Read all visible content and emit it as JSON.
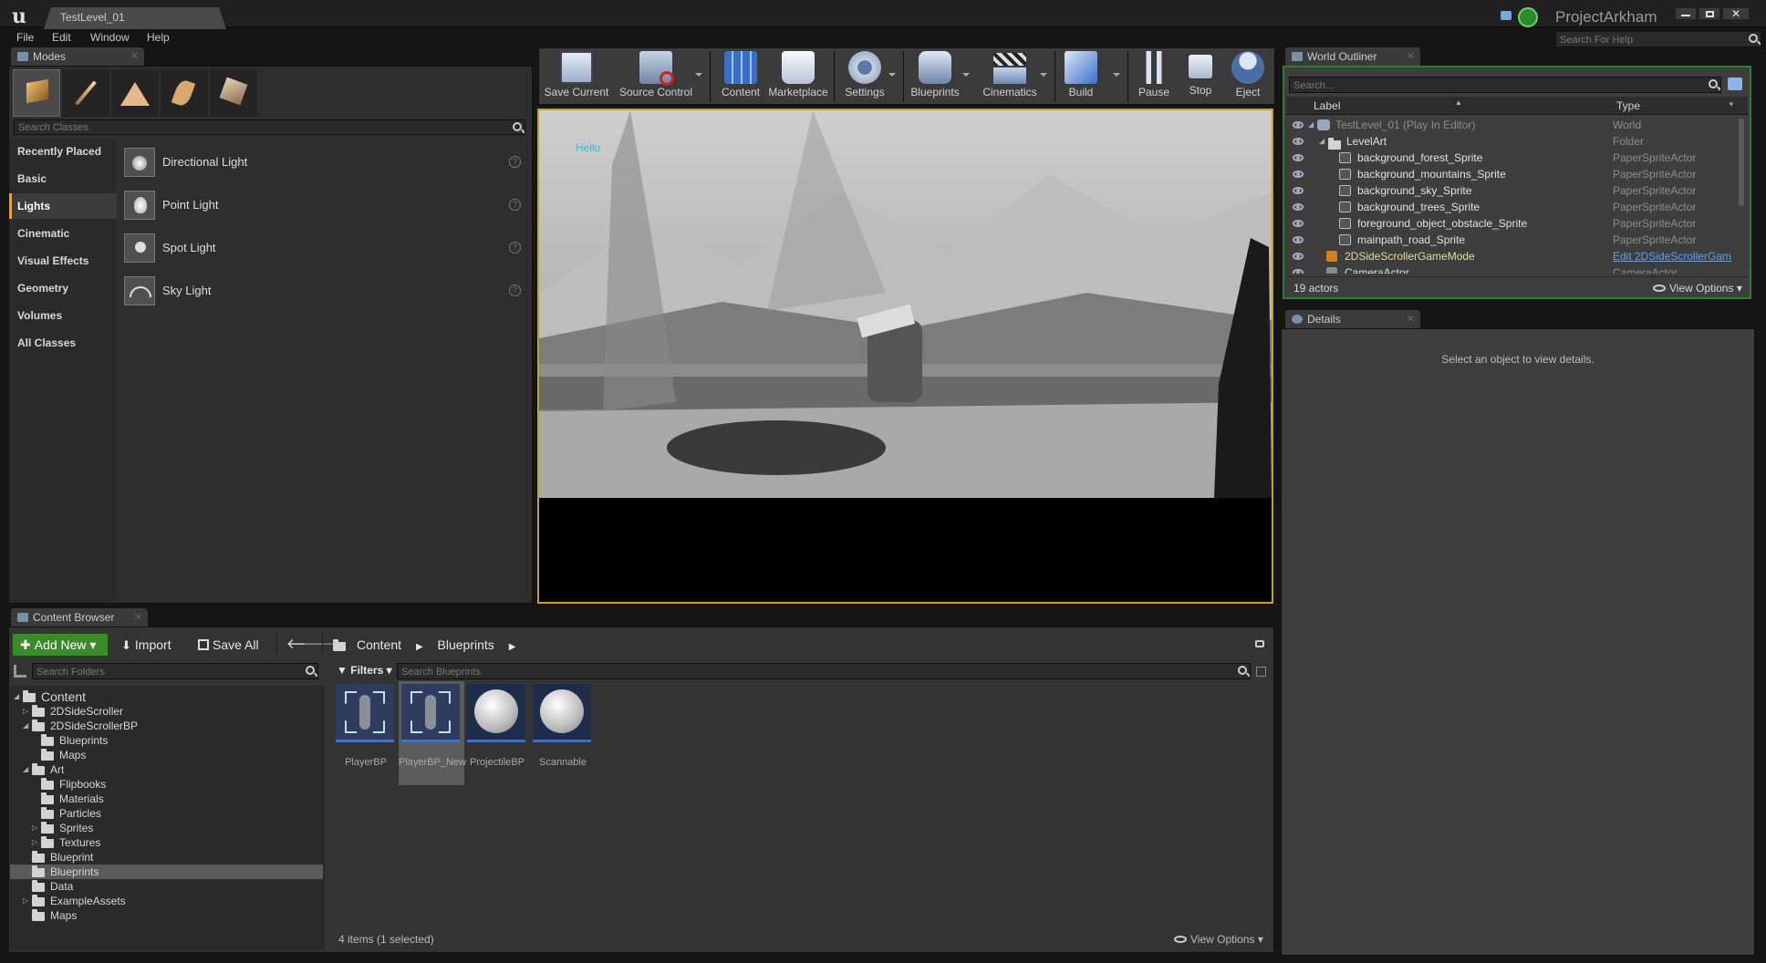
{
  "window": {
    "tab_title": "TestLevel_01",
    "project_name": "ProjectArkham",
    "help_search_placeholder": "Search For Help"
  },
  "menu": [
    "File",
    "Edit",
    "Window",
    "Help"
  ],
  "modes": {
    "tab_label": "Modes",
    "search_placeholder": "Search Classes",
    "categories": [
      "Recently Placed",
      "Basic",
      "Lights",
      "Cinematic",
      "Visual Effects",
      "Geometry",
      "Volumes",
      "All Classes"
    ],
    "selected_category": "Lights",
    "items": [
      {
        "label": "Directional Light",
        "icon": "directional-light-icon"
      },
      {
        "label": "Point Light",
        "icon": "point-light-icon"
      },
      {
        "label": "Spot Light",
        "icon": "spot-light-icon"
      },
      {
        "label": "Sky Light",
        "icon": "sky-light-icon"
      }
    ]
  },
  "toolbar": {
    "buttons": [
      {
        "label": "Save Current",
        "icon": "save-icon"
      },
      {
        "label": "Source Control",
        "icon": "source-control-icon"
      },
      {
        "label": "Content",
        "icon": "content-icon"
      },
      {
        "label": "Marketplace",
        "icon": "marketplace-icon"
      },
      {
        "label": "Settings",
        "icon": "settings-icon"
      },
      {
        "label": "Blueprints",
        "icon": "blueprints-icon"
      },
      {
        "label": "Cinematics",
        "icon": "cinematics-icon"
      },
      {
        "label": "Build",
        "icon": "build-icon"
      },
      {
        "label": "Pause",
        "icon": "pause-icon"
      },
      {
        "label": "Stop",
        "icon": "stop-icon"
      },
      {
        "label": "Eject",
        "icon": "eject-icon"
      }
    ]
  },
  "viewport": {
    "overlay_text": "Hello"
  },
  "outliner": {
    "tab_label": "World Outliner",
    "search_placeholder": "Search...",
    "col_label": "Label",
    "col_type": "Type",
    "rows": [
      {
        "label": "TestLevel_01 (Play In Editor)",
        "type": "World"
      },
      {
        "label": "LevelArt",
        "type": "Folder"
      },
      {
        "label": "background_forest_Sprite",
        "type": "PaperSpriteActor"
      },
      {
        "label": "background_mountains_Sprite",
        "type": "PaperSpriteActor"
      },
      {
        "label": "background_sky_Sprite",
        "type": "PaperSpriteActor"
      },
      {
        "label": "background_trees_Sprite",
        "type": "PaperSpriteActor"
      },
      {
        "label": "foreground_object_obstacle_Sprite",
        "type": "PaperSpriteActor"
      },
      {
        "label": "mainpath_road_Sprite",
        "type": "PaperSpriteActor"
      },
      {
        "label": "2DSideScrollerGameMode",
        "type": "Edit 2DSideScrollerGam"
      },
      {
        "label": "CameraActor",
        "type": "CameraActor"
      }
    ],
    "actor_count": "19 actors",
    "view_options": "View Options"
  },
  "details": {
    "tab_label": "Details",
    "empty_message": "Select an object to view details."
  },
  "content_browser": {
    "tab_label": "Content Browser",
    "add_new": "Add New",
    "import": "Import",
    "save_all": "Save All",
    "path": [
      "Content",
      "Blueprints"
    ],
    "search_folders_placeholder": "Search Folders",
    "filters": "Filters",
    "search_assets_placeholder": "Search Blueprints",
    "tree": [
      {
        "label": "Content",
        "level": 0,
        "exp": "open"
      },
      {
        "label": "2DSideScroller",
        "level": 1,
        "exp": "closed"
      },
      {
        "label": "2DSideScrollerBP",
        "level": 1,
        "exp": "open"
      },
      {
        "label": "Blueprints",
        "level": 2,
        "exp": ""
      },
      {
        "label": "Maps",
        "level": 2,
        "exp": ""
      },
      {
        "label": "Art",
        "level": 1,
        "exp": "open"
      },
      {
        "label": "Flipbooks",
        "level": 2,
        "exp": ""
      },
      {
        "label": "Materials",
        "level": 2,
        "exp": ""
      },
      {
        "label": "Particles",
        "level": 2,
        "exp": ""
      },
      {
        "label": "Sprites",
        "level": 2,
        "exp": "closed"
      },
      {
        "label": "Textures",
        "level": 2,
        "exp": "closed"
      },
      {
        "label": "Blueprint",
        "level": 1,
        "exp": ""
      },
      {
        "label": "Blueprints",
        "level": 1,
        "exp": "",
        "selected": true
      },
      {
        "label": "Data",
        "level": 1,
        "exp": ""
      },
      {
        "label": "ExampleAssets",
        "level": 1,
        "exp": "closed"
      },
      {
        "label": "Maps",
        "level": 1,
        "exp": ""
      }
    ],
    "assets": [
      {
        "label": "PlayerBP",
        "kind": "character",
        "selected": false
      },
      {
        "label": "PlayerBP_New",
        "kind": "character",
        "selected": true
      },
      {
        "label": "ProjectileBP",
        "kind": "sphere",
        "selected": false
      },
      {
        "label": "Scannable",
        "kind": "sphere",
        "selected": false
      }
    ],
    "status": "4 items (1 selected)",
    "view_options": "View Options"
  }
}
